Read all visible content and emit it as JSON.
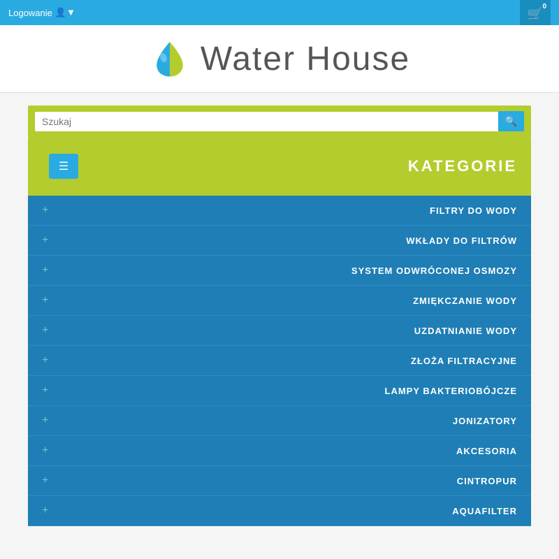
{
  "topbar": {
    "login_label": "Logowanie",
    "cart_count": "0"
  },
  "logo": {
    "text": "Water House"
  },
  "search": {
    "placeholder": "Szukaj"
  },
  "categories": {
    "header_label": "KATEGORIE",
    "items": [
      {
        "label": "FILTRY DO WODY"
      },
      {
        "label": "WKŁADY DO FILTRÓW"
      },
      {
        "label": "SYSTEM ODWRÓCONEJ OSMOZY"
      },
      {
        "label": "ZMIĘKCZANIE WODY"
      },
      {
        "label": "UZDATNIANIE WODY"
      },
      {
        "label": "ZŁOŻA FILTRACYJNE"
      },
      {
        "label": "LAMPY BAKTERIOBÓJCZE"
      },
      {
        "label": "JONIZATORY"
      },
      {
        "label": "AKCESORIA"
      },
      {
        "label": "CINTROPUR"
      },
      {
        "label": "AQUAFILTER"
      }
    ]
  },
  "colors": {
    "top_bar": "#29abe2",
    "lime": "#b5cc2e",
    "blue": "#1e7eb5"
  }
}
